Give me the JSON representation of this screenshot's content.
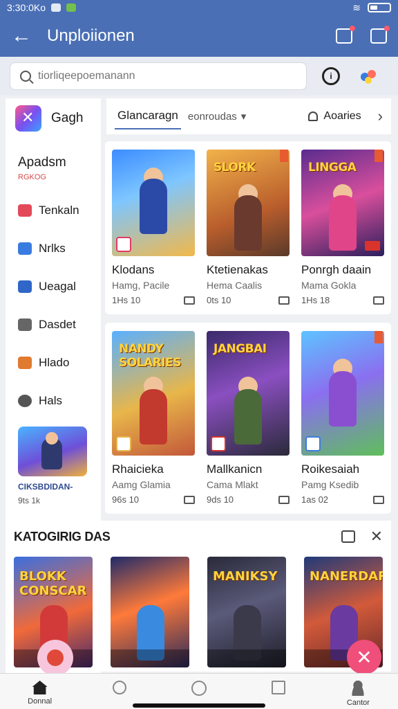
{
  "status": {
    "time": "3:30:0Ko"
  },
  "appbar": {
    "title": "Unploiionen",
    "back_icon": "arrow-left-icon",
    "actions": [
      "camera-icon",
      "edit-icon"
    ]
  },
  "search": {
    "placeholder": "tiorliqeepoemanann"
  },
  "sidebar": {
    "app_label": "Gagh",
    "section_title": "Apadsm",
    "section_sub": "RGKOG",
    "items": [
      {
        "label": "Tenkaln",
        "color": "#e24a5a"
      },
      {
        "label": "Nrlks",
        "color": "#3a7be0"
      },
      {
        "label": "Ueagal",
        "color": "#2f66c8"
      },
      {
        "label": "Dasdet",
        "color": "#666666"
      },
      {
        "label": "Hlado",
        "color": "#e07a30"
      },
      {
        "label": "Hals",
        "color": "#555555"
      }
    ],
    "promo": {
      "title": "CIKSBDIDAN-",
      "meta": "9ts 1k"
    }
  },
  "tabs": {
    "active": "Glancaragn",
    "secondary": "eonroudas",
    "right": "Aoaries"
  },
  "panel1": [
    {
      "title": "Klodans",
      "sub": "Hamg, Pacile",
      "meta": "1Hs 10",
      "logo": "",
      "bg": "linear-gradient(160deg,#3b8cff,#7ec6ff 40%,#f2b84a)",
      "hero": "#2b4aa8"
    },
    {
      "title": "Ktetienakas",
      "sub": "Hema Caalis",
      "meta": "0ts 10",
      "logo": "SLORK",
      "bg": "linear-gradient(160deg,#f2b24a,#b85d2c 60%,#5a3a2a)",
      "hero": "#6a3a2e"
    },
    {
      "title": "Ponrgh daain",
      "sub": "Mama Gokla",
      "meta": "1Hs 18",
      "logo": "LINGGA",
      "bg": "linear-gradient(160deg,#5a2c8f,#d94f9c 50%,#2b1f5c)",
      "hero": "#e0458a"
    }
  ],
  "panel2": [
    {
      "title": "Rhaicieka",
      "sub": "Aamg Glamia",
      "meta": "96s 10",
      "logo": "NANDY SOLARIES",
      "bg": "linear-gradient(160deg,#5ab0ff,#e8b64a 55%,#c2573a)",
      "hero": "#c23a2e"
    },
    {
      "title": "Mallkanicn",
      "sub": "Cama Mlakt",
      "meta": "9ds 10",
      "logo": "JANGBAI",
      "bg": "linear-gradient(160deg,#3a2a6a,#8a4fc0 45%,#2a2a3a)",
      "hero": "#4a6a3a"
    },
    {
      "title": "Roikesaiah",
      "sub": "Pamg Ksedib",
      "meta": "1as 02",
      "logo": "",
      "bg": "linear-gradient(160deg,#5ec3ff,#8a6ff0 45%,#5fbf5a)",
      "hero": "#8a4fd0"
    }
  ],
  "section": {
    "title": "KATOGIRIG DAS",
    "items": [
      {
        "logo": "BLOKK CONSCAR",
        "bg": "linear-gradient(160deg,#3a6fe0,#f06a3a 55%,#4a2a6a)",
        "hero": "#d23a3a"
      },
      {
        "logo": "",
        "bg": "linear-gradient(160deg,#1f2a6a,#ff7a3a 45%,#2a2a5a)",
        "hero": "#3a8ae0"
      },
      {
        "logo": "MANIKSY",
        "bg": "linear-gradient(160deg,#2a2a3a,#5a5a7a 45%,#1f1f2a)",
        "hero": "#3a3a4a"
      },
      {
        "logo": "NANERDAR",
        "bg": "linear-gradient(160deg,#1f3a7a,#d25a3a 50%,#6a2a2a)",
        "hero": "#6a3aa0"
      }
    ]
  },
  "bottomnav": {
    "home": "Donnal",
    "profile": "Cantor"
  }
}
